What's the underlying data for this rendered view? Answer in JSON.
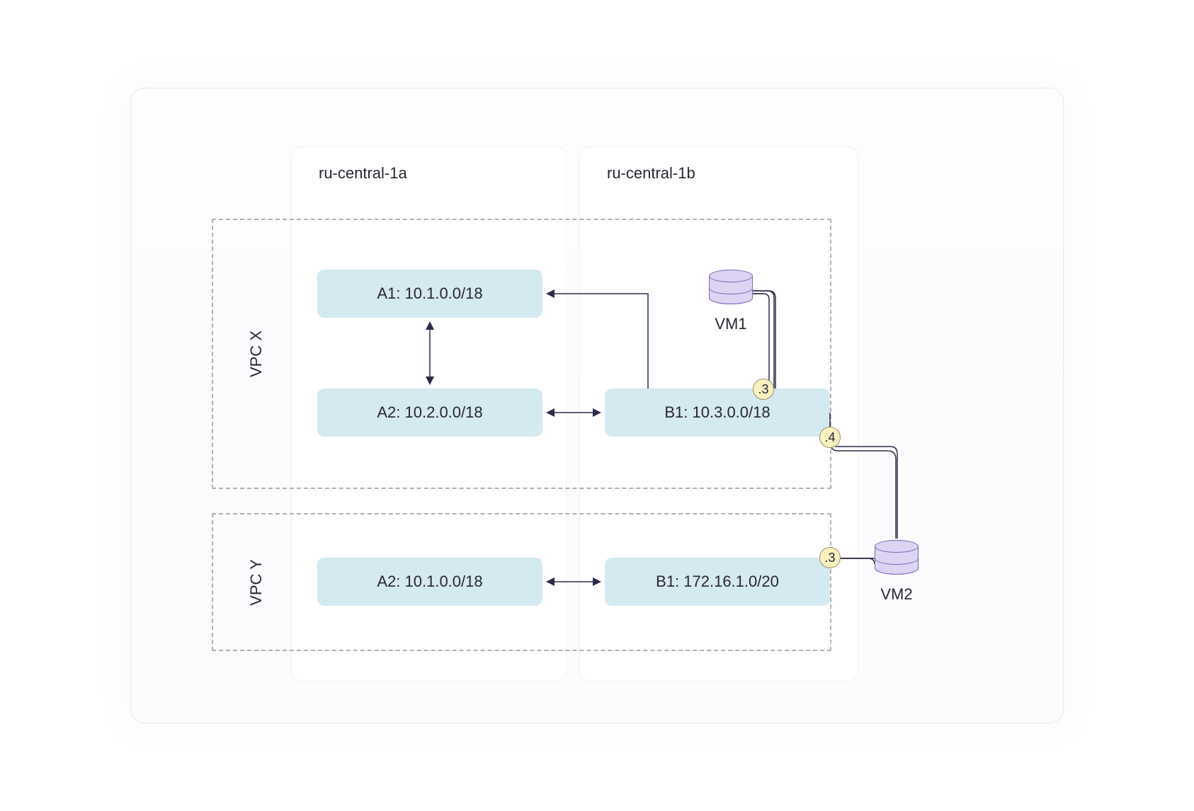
{
  "zones": {
    "a": {
      "label": "ru-central-1a"
    },
    "b": {
      "label": "ru-central-1b"
    }
  },
  "vpcs": {
    "x": {
      "label": "VPC X"
    },
    "y": {
      "label": "VPC Y"
    }
  },
  "subnets": {
    "a1": {
      "label": "A1: 10.1.0.0/18"
    },
    "a2_x": {
      "label": "A2: 10.2.0.0/18"
    },
    "b1_x": {
      "label": "B1: 10.3.0.0/18"
    },
    "a2_y": {
      "label": "A2: 10.1.0.0/18"
    },
    "b1_y": {
      "label": "B1: 172.16.1.0/20"
    }
  },
  "vms": {
    "vm1": {
      "label": "VM1"
    },
    "vm2": {
      "label": "VM2"
    }
  },
  "badges": {
    "b3a": ".3",
    "b4": ".4",
    "b3b": ".3"
  }
}
